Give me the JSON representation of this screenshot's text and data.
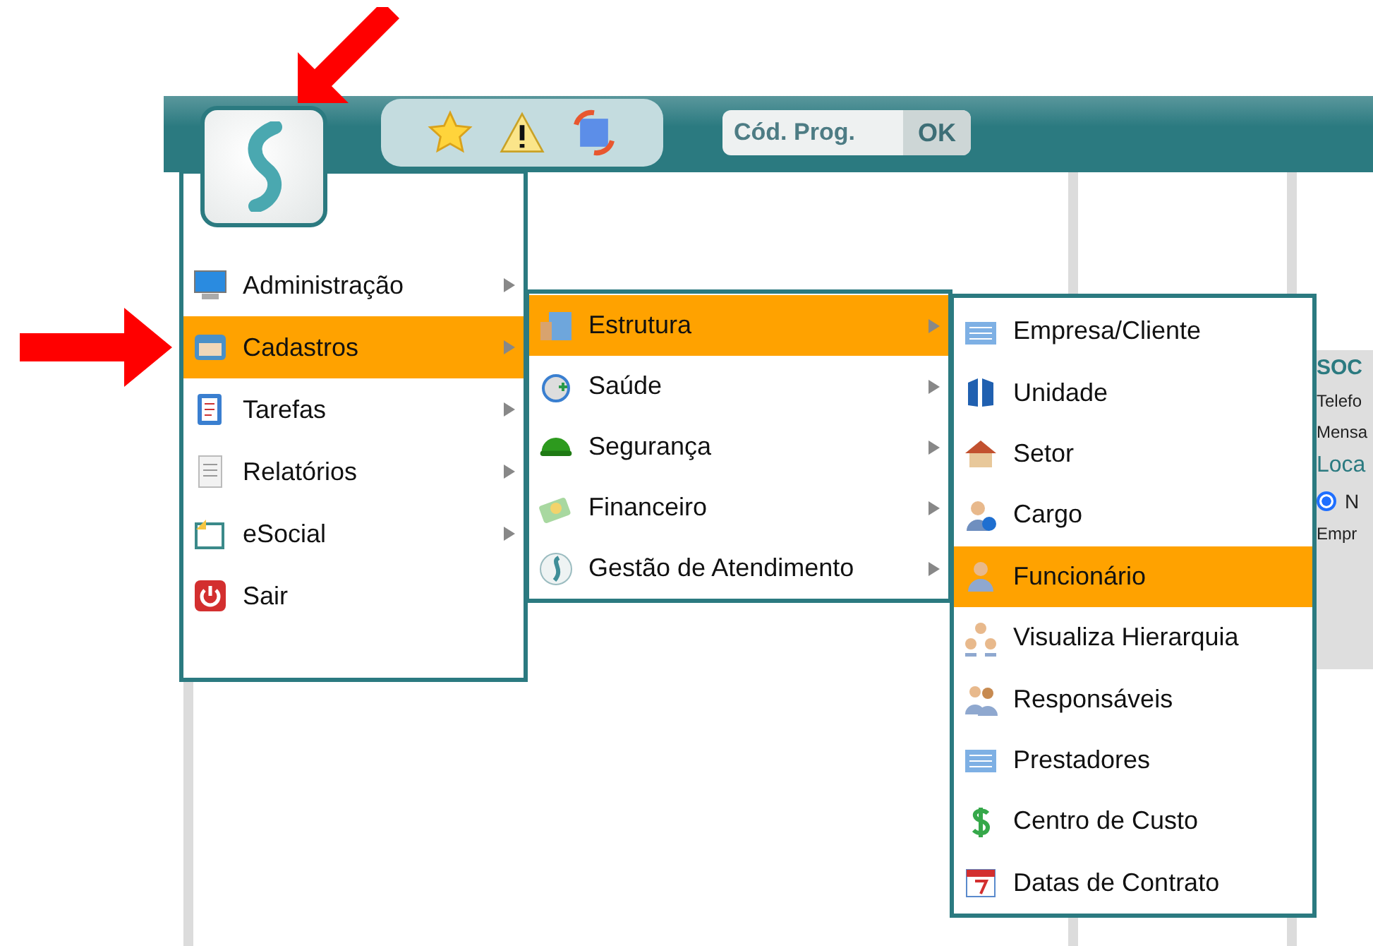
{
  "program_code": {
    "placeholder": "Cód. Prog.",
    "button": "OK"
  },
  "main_menu": [
    {
      "label": "Administração",
      "kind": "monitor",
      "submenu": true,
      "selected": false
    },
    {
      "label": "Cadastros",
      "kind": "card",
      "submenu": true,
      "selected": true
    },
    {
      "label": "Tarefas",
      "kind": "tasks",
      "submenu": true,
      "selected": false
    },
    {
      "label": "Relatórios",
      "kind": "report",
      "submenu": true,
      "selected": false
    },
    {
      "label": "eSocial",
      "kind": "frame",
      "submenu": true,
      "selected": false
    },
    {
      "label": "Sair",
      "kind": "power",
      "submenu": false,
      "selected": false
    }
  ],
  "cadastros_menu": [
    {
      "label": "Estrutura",
      "kind": "building",
      "submenu": true,
      "selected": true
    },
    {
      "label": "Saúde",
      "kind": "health",
      "submenu": true,
      "selected": false
    },
    {
      "label": "Segurança",
      "kind": "helmet",
      "submenu": true,
      "selected": false
    },
    {
      "label": "Financeiro",
      "kind": "money",
      "submenu": true,
      "selected": false
    },
    {
      "label": "Gestão de Atendimento",
      "kind": "logo",
      "submenu": true,
      "selected": false
    }
  ],
  "estrutura_menu": [
    {
      "label": "Empresa/Cliente",
      "kind": "office",
      "selected": false
    },
    {
      "label": "Unidade",
      "kind": "columns",
      "selected": false
    },
    {
      "label": "Setor",
      "kind": "house",
      "selected": false
    },
    {
      "label": "Cargo",
      "kind": "person_info",
      "selected": false
    },
    {
      "label": "Funcionário",
      "kind": "person",
      "selected": true
    },
    {
      "label": "Visualiza Hierarquia",
      "kind": "hierarchy",
      "selected": false
    },
    {
      "label": "Responsáveis",
      "kind": "people",
      "selected": false
    },
    {
      "label": "Prestadores",
      "kind": "office",
      "selected": false
    },
    {
      "label": "Centro de Custo",
      "kind": "dollar",
      "selected": false
    },
    {
      "label": "Datas de Contrato",
      "kind": "calendar",
      "selected": false
    }
  ],
  "background_panel": {
    "heading": "SOC",
    "lines": [
      "Telefo",
      "Mensa"
    ],
    "section": "Loca",
    "radio": {
      "label": "N",
      "selected": true
    },
    "field": "Empr"
  }
}
